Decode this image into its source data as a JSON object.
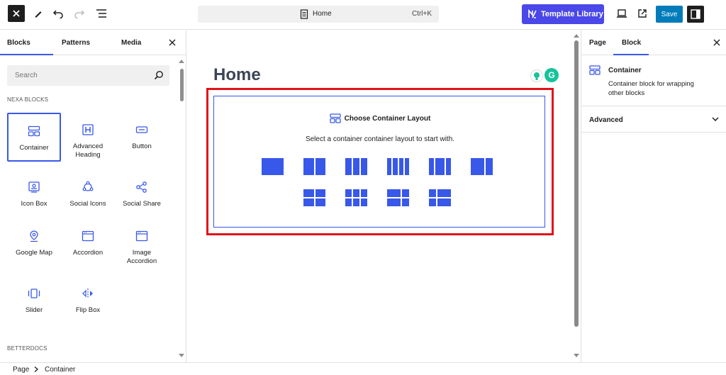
{
  "topbar": {
    "document_title": "Home",
    "shortcut": "Ctrl+K",
    "template_library_label": "Template Library",
    "save_label": "Save"
  },
  "inserter": {
    "tabs": [
      "Blocks",
      "Patterns",
      "Media"
    ],
    "active_tab": "Blocks",
    "search_placeholder": "Search",
    "categories": [
      {
        "name": "NEXA BLOCKS",
        "blocks": [
          {
            "label": "Container",
            "icon": "container-icon",
            "selected": true
          },
          {
            "label": "Advanced Heading",
            "icon": "heading-icon"
          },
          {
            "label": "Button",
            "icon": "button-icon"
          },
          {
            "label": "Icon Box",
            "icon": "icon-box-icon"
          },
          {
            "label": "Social Icons",
            "icon": "social-icons-icon"
          },
          {
            "label": "Social Share",
            "icon": "share-icon"
          },
          {
            "label": "Google Map",
            "icon": "map-pin-icon"
          },
          {
            "label": "Accordion",
            "icon": "accordion-icon"
          },
          {
            "label": "Image Accordion",
            "icon": "image-accordion-icon"
          },
          {
            "label": "Slider",
            "icon": "slider-icon"
          },
          {
            "label": "Flip Box",
            "icon": "flip-box-icon"
          }
        ]
      },
      {
        "name": "BETTERDOCS",
        "blocks": []
      }
    ]
  },
  "canvas": {
    "page_title": "Home",
    "container_placeholder": {
      "heading": "Choose Container Layout",
      "subtext": "Select a container container layout to start with.",
      "layouts_row1": [
        "1-column",
        "2-columns",
        "3-columns",
        "4-columns",
        "3-columns-wide-center",
        "2-columns-wide-left"
      ],
      "layouts_row2": [
        "2x2-grid",
        "3x2-grid",
        "2x2-wide-right-top",
        "2x2-wide-left-top"
      ]
    }
  },
  "settings": {
    "tabs": [
      "Page",
      "Block"
    ],
    "active_tab": "Block",
    "block_name": "Container",
    "block_description": "Container block for wrapping other blocks",
    "sections": [
      "Advanced"
    ]
  },
  "breadcrumb": [
    "Page",
    "Container"
  ],
  "colors": {
    "accent": "#3858e9",
    "template_library": "#4a48e8",
    "highlight_frame": "#e0131b",
    "save": "#007cba"
  }
}
